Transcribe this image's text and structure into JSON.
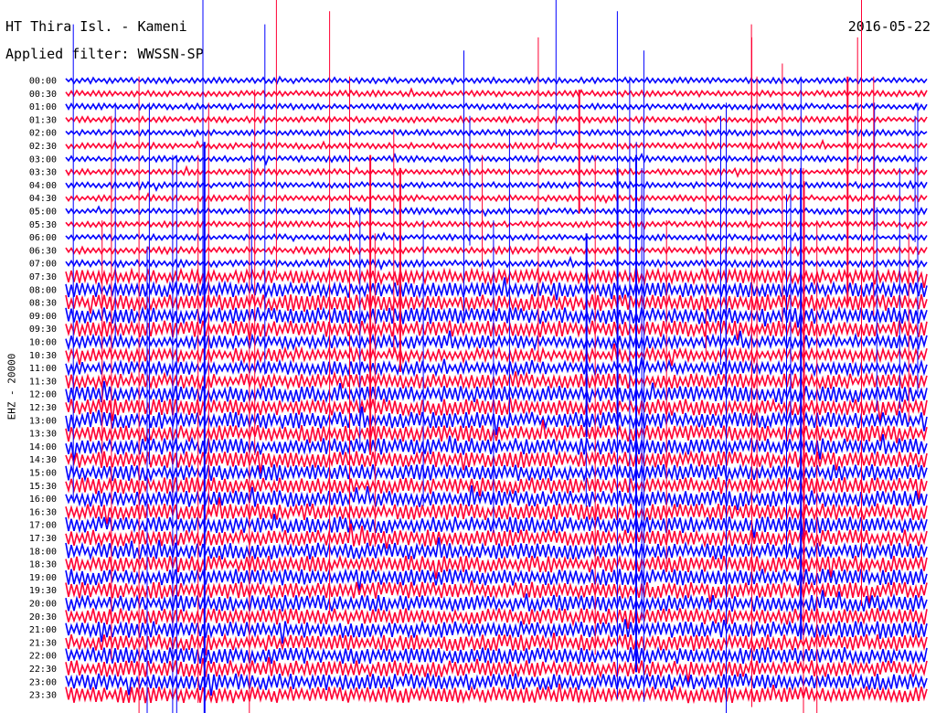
{
  "header": {
    "station": "HT Thira Isl. - Kameni",
    "date": "2016-05-22",
    "filter": "Applied filter: WWSSN-SP"
  },
  "chart_data": {
    "type": "line",
    "description_kind": "helicorder",
    "channel_label": "EHZ - 20000",
    "row_labels": [
      "00:00",
      "00:30",
      "01:00",
      "01:30",
      "02:00",
      "02:30",
      "03:00",
      "03:30",
      "04:00",
      "04:30",
      "05:00",
      "05:30",
      "06:00",
      "06:30",
      "07:00",
      "07:30",
      "08:00",
      "08:30",
      "09:00",
      "09:30",
      "10:00",
      "10:30",
      "11:00",
      "11:30",
      "12:00",
      "12:30",
      "13:00",
      "13:30",
      "14:00",
      "14:30",
      "15:00",
      "15:30",
      "16:00",
      "16:30",
      "17:00",
      "17:30",
      "18:00",
      "18:30",
      "19:00",
      "19:30",
      "20:00",
      "20:30",
      "21:00",
      "21:30",
      "22:00",
      "22:30",
      "23:00",
      "23:30"
    ],
    "row_minutes": 30,
    "trace_colors": [
      "#0000ff",
      "#ff0033"
    ],
    "amplitude_levels": [
      0.35,
      0.35,
      0.35,
      0.35,
      0.35,
      0.35,
      0.35,
      0.35,
      0.35,
      0.35,
      0.35,
      0.35,
      0.35,
      0.4,
      0.4,
      0.8,
      0.9,
      1.0,
      1.0,
      1.0,
      0.8,
      0.8,
      0.8,
      0.9,
      1.0,
      1.0,
      1.0,
      1.0,
      1.0,
      1.0,
      1.0,
      1.0,
      1.0,
      1.0,
      1.0,
      1.0,
      1.0,
      1.0,
      1.0,
      1.0,
      1.0,
      1.0,
      1.0,
      1.0,
      1.0,
      1.0,
      1.0,
      1.0
    ],
    "grid": false,
    "legend": "none"
  }
}
